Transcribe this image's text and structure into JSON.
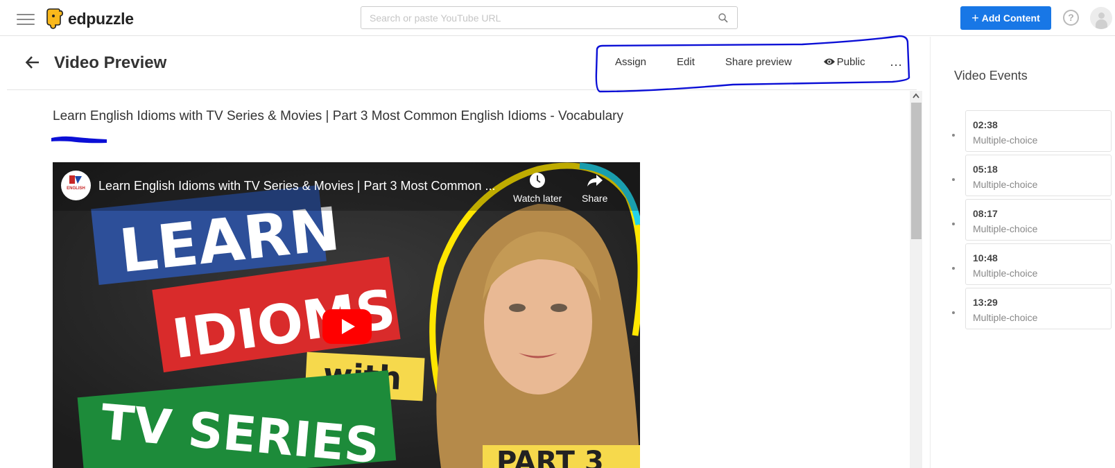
{
  "topbar": {
    "logo_text": "edpuzzle",
    "search_placeholder": "Search or paste YouTube URL",
    "add_content_label": "Add Content",
    "help_symbol": "?"
  },
  "header": {
    "title": "Video Preview",
    "actions": {
      "assign": "Assign",
      "edit": "Edit",
      "share_preview": "Share preview",
      "public": "Public",
      "more": "..."
    }
  },
  "video": {
    "title": "Learn English Idioms with TV Series & Movies | Part 3 Most Common English Idioms - Vocabulary",
    "player": {
      "overlay_title": "Learn English Idioms with TV Series & Movies | Part 3 Most Common ...",
      "channel_label": "ENGLISH",
      "watch_later": "Watch later",
      "share": "Share",
      "thumbnail_text": {
        "line1": "LEARN",
        "line2": "IDIOMS",
        "line3": "with",
        "line4": "TV SERIES",
        "line5": "PART 3"
      }
    }
  },
  "sidebar": {
    "title": "Video Events",
    "events": [
      {
        "time": "02:38",
        "type": "Multiple-choice"
      },
      {
        "time": "05:18",
        "type": "Multiple-choice"
      },
      {
        "time": "08:17",
        "type": "Multiple-choice"
      },
      {
        "time": "10:48",
        "type": "Multiple-choice"
      },
      {
        "time": "13:29",
        "type": "Multiple-choice"
      }
    ]
  },
  "colors": {
    "accent_blue": "#1877e6",
    "annotation_blue": "#0b0fd6",
    "logo_yellow": "#f9b81c",
    "youtube_red": "#ff0000"
  }
}
